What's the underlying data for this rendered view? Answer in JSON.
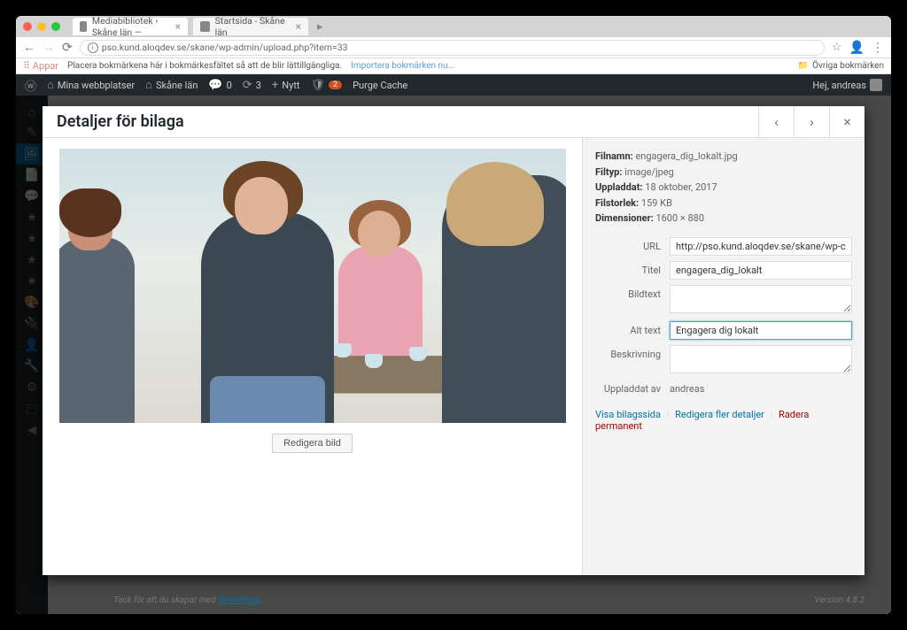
{
  "browser": {
    "tabs": [
      {
        "label": "Mediabibliotek ‹ Skåne län —",
        "active": true
      },
      {
        "label": "Startsida - Skåne län",
        "active": false
      }
    ],
    "url": "pso.kund.aloqdev.se/skane/wp-admin/upload.php?item=33",
    "bookmarks": {
      "apps": "Appar",
      "hint": "Placera bokmärkena här i bokmärkesfältet så att de blir lättillgängliga.",
      "import": "Importera bokmärken nu...",
      "other": "Övriga bokmärken"
    }
  },
  "wpbar": {
    "mysites": "Mina webbplatser",
    "sitename": "Skåne län",
    "comments": "0",
    "updates": "3",
    "new_label": "Nytt",
    "notif": "2",
    "purge": "Purge Cache",
    "greeting": "Hej, andreas"
  },
  "modal": {
    "title": "Detaljer för bilaga",
    "edit_image": "Redigera bild",
    "meta": {
      "filename_label": "Filnamn:",
      "filename": "engagera_dig_lokalt.jpg",
      "filetype_label": "Filtyp:",
      "filetype": "image/jpeg",
      "uploaded_label": "Uppladdat:",
      "uploaded": "18 oktober, 2017",
      "filesize_label": "Filstorlek:",
      "filesize": "159 KB",
      "dimensions_label": "Dimensioner:",
      "dimensions": "1600 × 880"
    },
    "fields": {
      "url_label": "URL",
      "url": "http://pso.kund.aloqdev.se/skane/wp-content/uploa",
      "title_label": "Titel",
      "title": "engagera_dig_lokalt",
      "caption_label": "Bildtext",
      "caption": "",
      "alt_label": "Alt text",
      "alt": "Engagera dig lokalt",
      "desc_label": "Beskrivning",
      "desc": "",
      "uploader_label": "Uppladdat av",
      "uploader": "andreas"
    },
    "links": {
      "view": "Visa bilagssida",
      "more": "Redigera fler detaljer",
      "delete": "Radera permanent"
    }
  },
  "footer": {
    "thanks": "Tack för att du skapar med ",
    "wp": "WordPress",
    "version": "Version 4.8.2"
  }
}
